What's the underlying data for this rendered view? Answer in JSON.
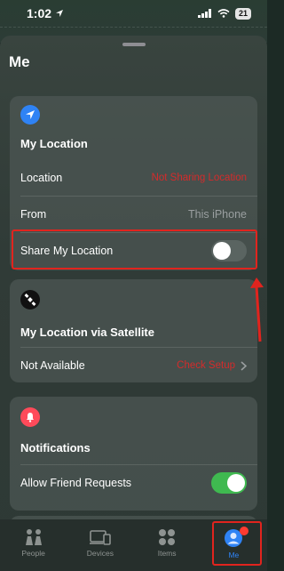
{
  "status_bar": {
    "time": "1:02",
    "battery": "21"
  },
  "sheet": {
    "title": "Me"
  },
  "my_location": {
    "heading": "My Location",
    "location_label": "Location",
    "location_value": "Not Sharing Location",
    "from_label": "From",
    "from_value": "This iPhone",
    "share_label": "Share My Location",
    "share_enabled": false
  },
  "satellite": {
    "heading": "My Location via Satellite",
    "status_label": "Not Available",
    "status_value": "Check Setup"
  },
  "notifications": {
    "heading": "Notifications",
    "friend_requests_label": "Allow Friend Requests",
    "friend_requests_enabled": true
  },
  "tabbar": {
    "tabs": [
      {
        "label": "People",
        "icon": "people-icon"
      },
      {
        "label": "Devices",
        "icon": "devices-icon"
      },
      {
        "label": "Items",
        "icon": "items-icon"
      },
      {
        "label": "Me",
        "icon": "me-icon",
        "active": true
      }
    ]
  },
  "colors": {
    "accent": "#2f83f5",
    "annotation_red": "#e1241e",
    "toggle_on": "#3fb950"
  }
}
